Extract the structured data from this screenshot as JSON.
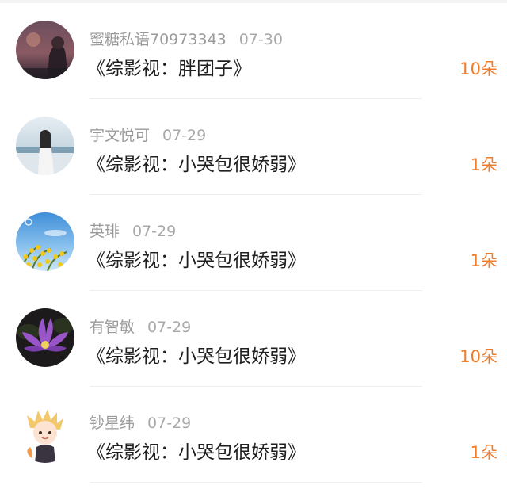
{
  "gift_list": {
    "items": [
      {
        "name": "蜜糖私语70973343",
        "date": "07-30",
        "book": "《综影视：胖团子》",
        "amount": "10朵",
        "avatar_icon": "night-sky-girl-avatar"
      },
      {
        "name": "宇文悦可",
        "date": "07-29",
        "book": "《综影视：小哭包很娇弱》",
        "amount": "1朵",
        "avatar_icon": "seaside-girl-avatar"
      },
      {
        "name": "英琲",
        "date": "07-29",
        "book": "《综影视：小哭包很娇弱》",
        "amount": "1朵",
        "avatar_icon": "yellow-flowers-sky-avatar"
      },
      {
        "name": "有智敏",
        "date": "07-29",
        "book": "《综影视：小哭包很娇弱》",
        "amount": "10朵",
        "avatar_icon": "purple-lotus-avatar"
      },
      {
        "name": "钞星纬",
        "date": "07-29",
        "book": "《综影视：小哭包很娇弱》",
        "amount": "1朵",
        "avatar_icon": "anime-character-avatar"
      }
    ]
  },
  "colors": {
    "amount": "#f07c2a",
    "name": "#9a9a9a",
    "title": "#1f1f1f"
  }
}
